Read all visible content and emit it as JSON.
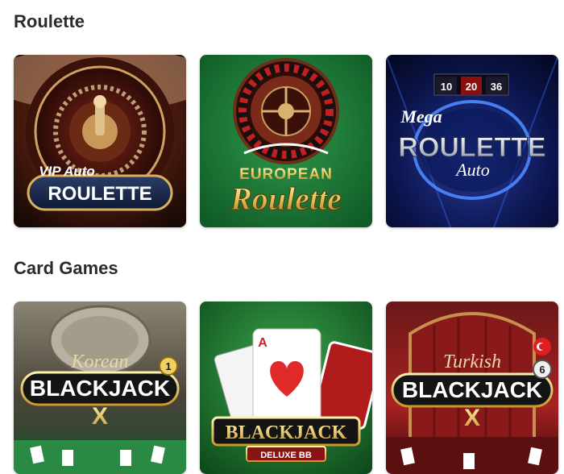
{
  "sections": [
    {
      "title": "Roulette",
      "games": [
        {
          "pre": "VIP Auto",
          "main": "ROULETTE"
        },
        {
          "pre": "EUROPEAN",
          "main": "Roulette"
        },
        {
          "pre": "Mega",
          "main": "ROULETTE",
          "sub": "Auto",
          "numbers": [
            "10",
            "20",
            "36"
          ]
        }
      ]
    },
    {
      "title": "Card Games",
      "games": [
        {
          "pre": "Korean",
          "main": "BLACKJACK",
          "badge": "1",
          "sub": "X"
        },
        {
          "main": "BLACKJACK",
          "sub": "DELUXE BB",
          "card_rank": "A"
        },
        {
          "pre": "Turkish",
          "main": "BLACKJACK",
          "badge": "6",
          "sub": "X"
        }
      ]
    }
  ],
  "colors": {
    "title": "#2b2b2b",
    "gold": "#e8c45a",
    "felt_green": "#1f7a3a",
    "casino_red": "#a51c1c",
    "neon_blue": "#2a5cff"
  }
}
